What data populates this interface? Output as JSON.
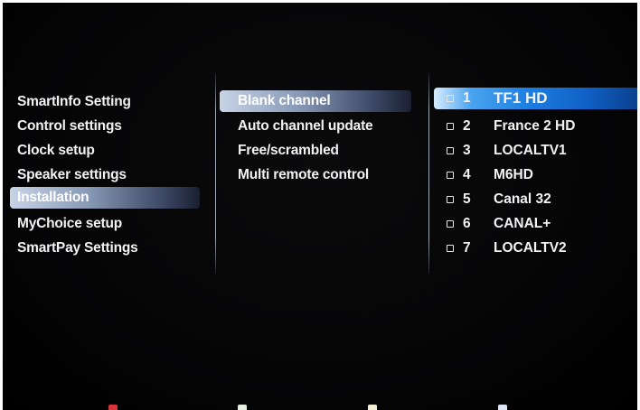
{
  "settings_menu": {
    "items": [
      {
        "label": "SmartInfo Setting"
      },
      {
        "label": "Control settings"
      },
      {
        "label": "Clock setup"
      },
      {
        "label": "Speaker settings"
      },
      {
        "label": "Installation",
        "selected": true
      },
      {
        "label": "MyChoice setup"
      },
      {
        "label": "SmartPay Settings"
      }
    ]
  },
  "installation_menu": {
    "items": [
      {
        "label": "Blank channel",
        "selected": true
      },
      {
        "label": "Auto channel update"
      },
      {
        "label": "Free/scrambled"
      },
      {
        "label": "Multi remote control"
      }
    ]
  },
  "channel_list": {
    "items": [
      {
        "number": "1",
        "name": "TF1 HD",
        "checked": false,
        "focused": true
      },
      {
        "number": "2",
        "name": "France 2 HD",
        "checked": false
      },
      {
        "number": "3",
        "name": "LOCALTV1",
        "checked": false
      },
      {
        "number": "4",
        "name": "M6HD",
        "checked": false
      },
      {
        "number": "5",
        "name": "Canal 32",
        "checked": false
      },
      {
        "number": "6",
        "name": "CANAL+",
        "checked": false
      },
      {
        "number": "7",
        "name": "LOCALTV2",
        "checked": false
      }
    ]
  },
  "color_keys": {
    "red": "#d8323a",
    "green": "#e6f0e0",
    "yellow": "#f4f0d8",
    "blue": "#dce6f4"
  },
  "colors": {
    "highlight_blue": "#1d7fe0",
    "highlight_grey": "#8a9bb8",
    "background": "#000000"
  }
}
